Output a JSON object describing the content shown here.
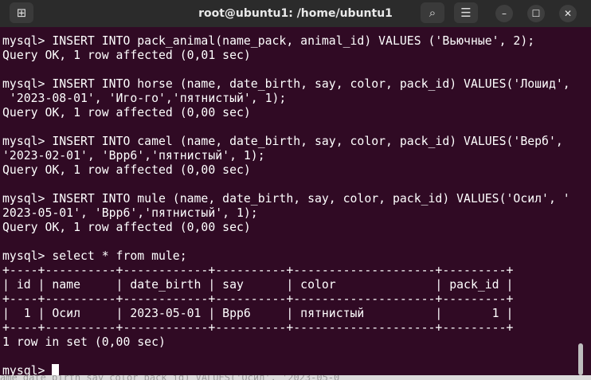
{
  "window": {
    "title": "root@ubuntu1: /home/ubuntu1"
  },
  "titlebar": {
    "new_tab_icon": "⊞",
    "search_icon": "⌕",
    "menu_icon": "☰",
    "minimize_icon": "–",
    "maximize_icon": "☐",
    "close_icon": "✕"
  },
  "terminal": {
    "lines": [
      "mysql> INSERT INTO pack_animal(name_pack, animal_id) VALUES ('Вьючные', 2);",
      "Query OK, 1 row affected (0,01 sec)",
      "",
      "mysql> INSERT INTO horse (name, date_birth, say, color, pack_id) VALUES('Лошид',",
      " '2023-08-01', 'Иго-го','пятнистый', 1);",
      "Query OK, 1 row affected (0,00 sec)",
      "",
      "mysql> INSERT INTO camel (name, date_birth, say, color, pack_id) VALUES('Верб',",
      "'2023-02-01', 'Врр6','пятнистый', 1);",
      "Query OK, 1 row affected (0,00 sec)",
      "",
      "mysql> INSERT INTO mule (name, date_birth, say, color, pack_id) VALUES('Осил', '",
      "2023-05-01', 'Врр6','пятнистый', 1);",
      "Query OK, 1 row affected (0,00 sec)",
      "",
      "mysql> select * from mule;",
      "+----+----------+------------+----------+--------------------+---------+",
      "| id | name     | date_birth | say      | color              | pack_id |",
      "+----+----------+------------+----------+--------------------+---------+",
      "|  1 | Осил     | 2023-05-01 | Врр6     | пятнистый          |       1 |",
      "+----+----------+------------+----------+--------------------+---------+",
      "1 row in set (0,00 sec)",
      "",
      "mysql> "
    ]
  },
  "background_text": "ame date birth say color pack id) VALUES('Осил', '2023-05-0"
}
